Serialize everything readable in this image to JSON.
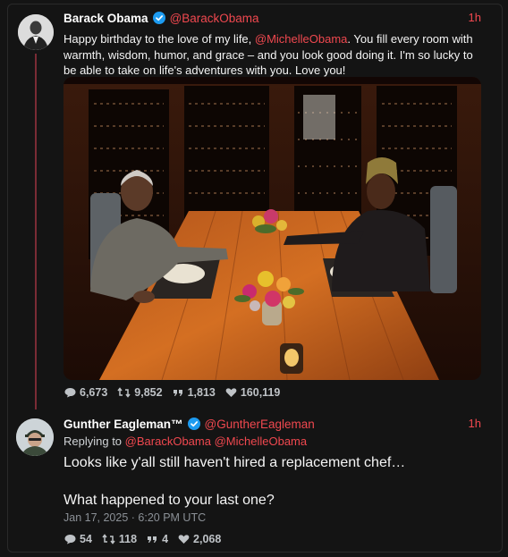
{
  "tweet": {
    "author_name": "Barack Obama",
    "handle": "@BarackObama",
    "time": "1h",
    "text_before": "Happy birthday to the love of my life, ",
    "mention": "@MichelleObama",
    "text_after": ". You fill every room with warmth, wisdom, humor, and grace – and you look good doing it. I'm so lucky to be able to take on life's adventures with you. Love you!",
    "stats": {
      "replies": "6,673",
      "retweets": "9,852",
      "quotes": "1,813",
      "likes": "160,119"
    }
  },
  "reply": {
    "author_name": "Gunther Eagleman™",
    "handle": "@GuntherEagleman",
    "time": "1h",
    "replying_label": "Replying to",
    "replying_to_1": "@BarackObama",
    "replying_to_2": "@MichelleObama",
    "line1": "Looks like y'all still haven't hired a replacement chef…",
    "line2": "What happened to your last one?",
    "date": "Jan 17, 2025 · 6:20 PM UTC",
    "stats": {
      "replies": "54",
      "retweets": "118",
      "quotes": "4",
      "likes": "2,068"
    }
  },
  "colors": {
    "accent": "#f0484f",
    "background": "#141414",
    "verified": "#1d9bf0"
  }
}
